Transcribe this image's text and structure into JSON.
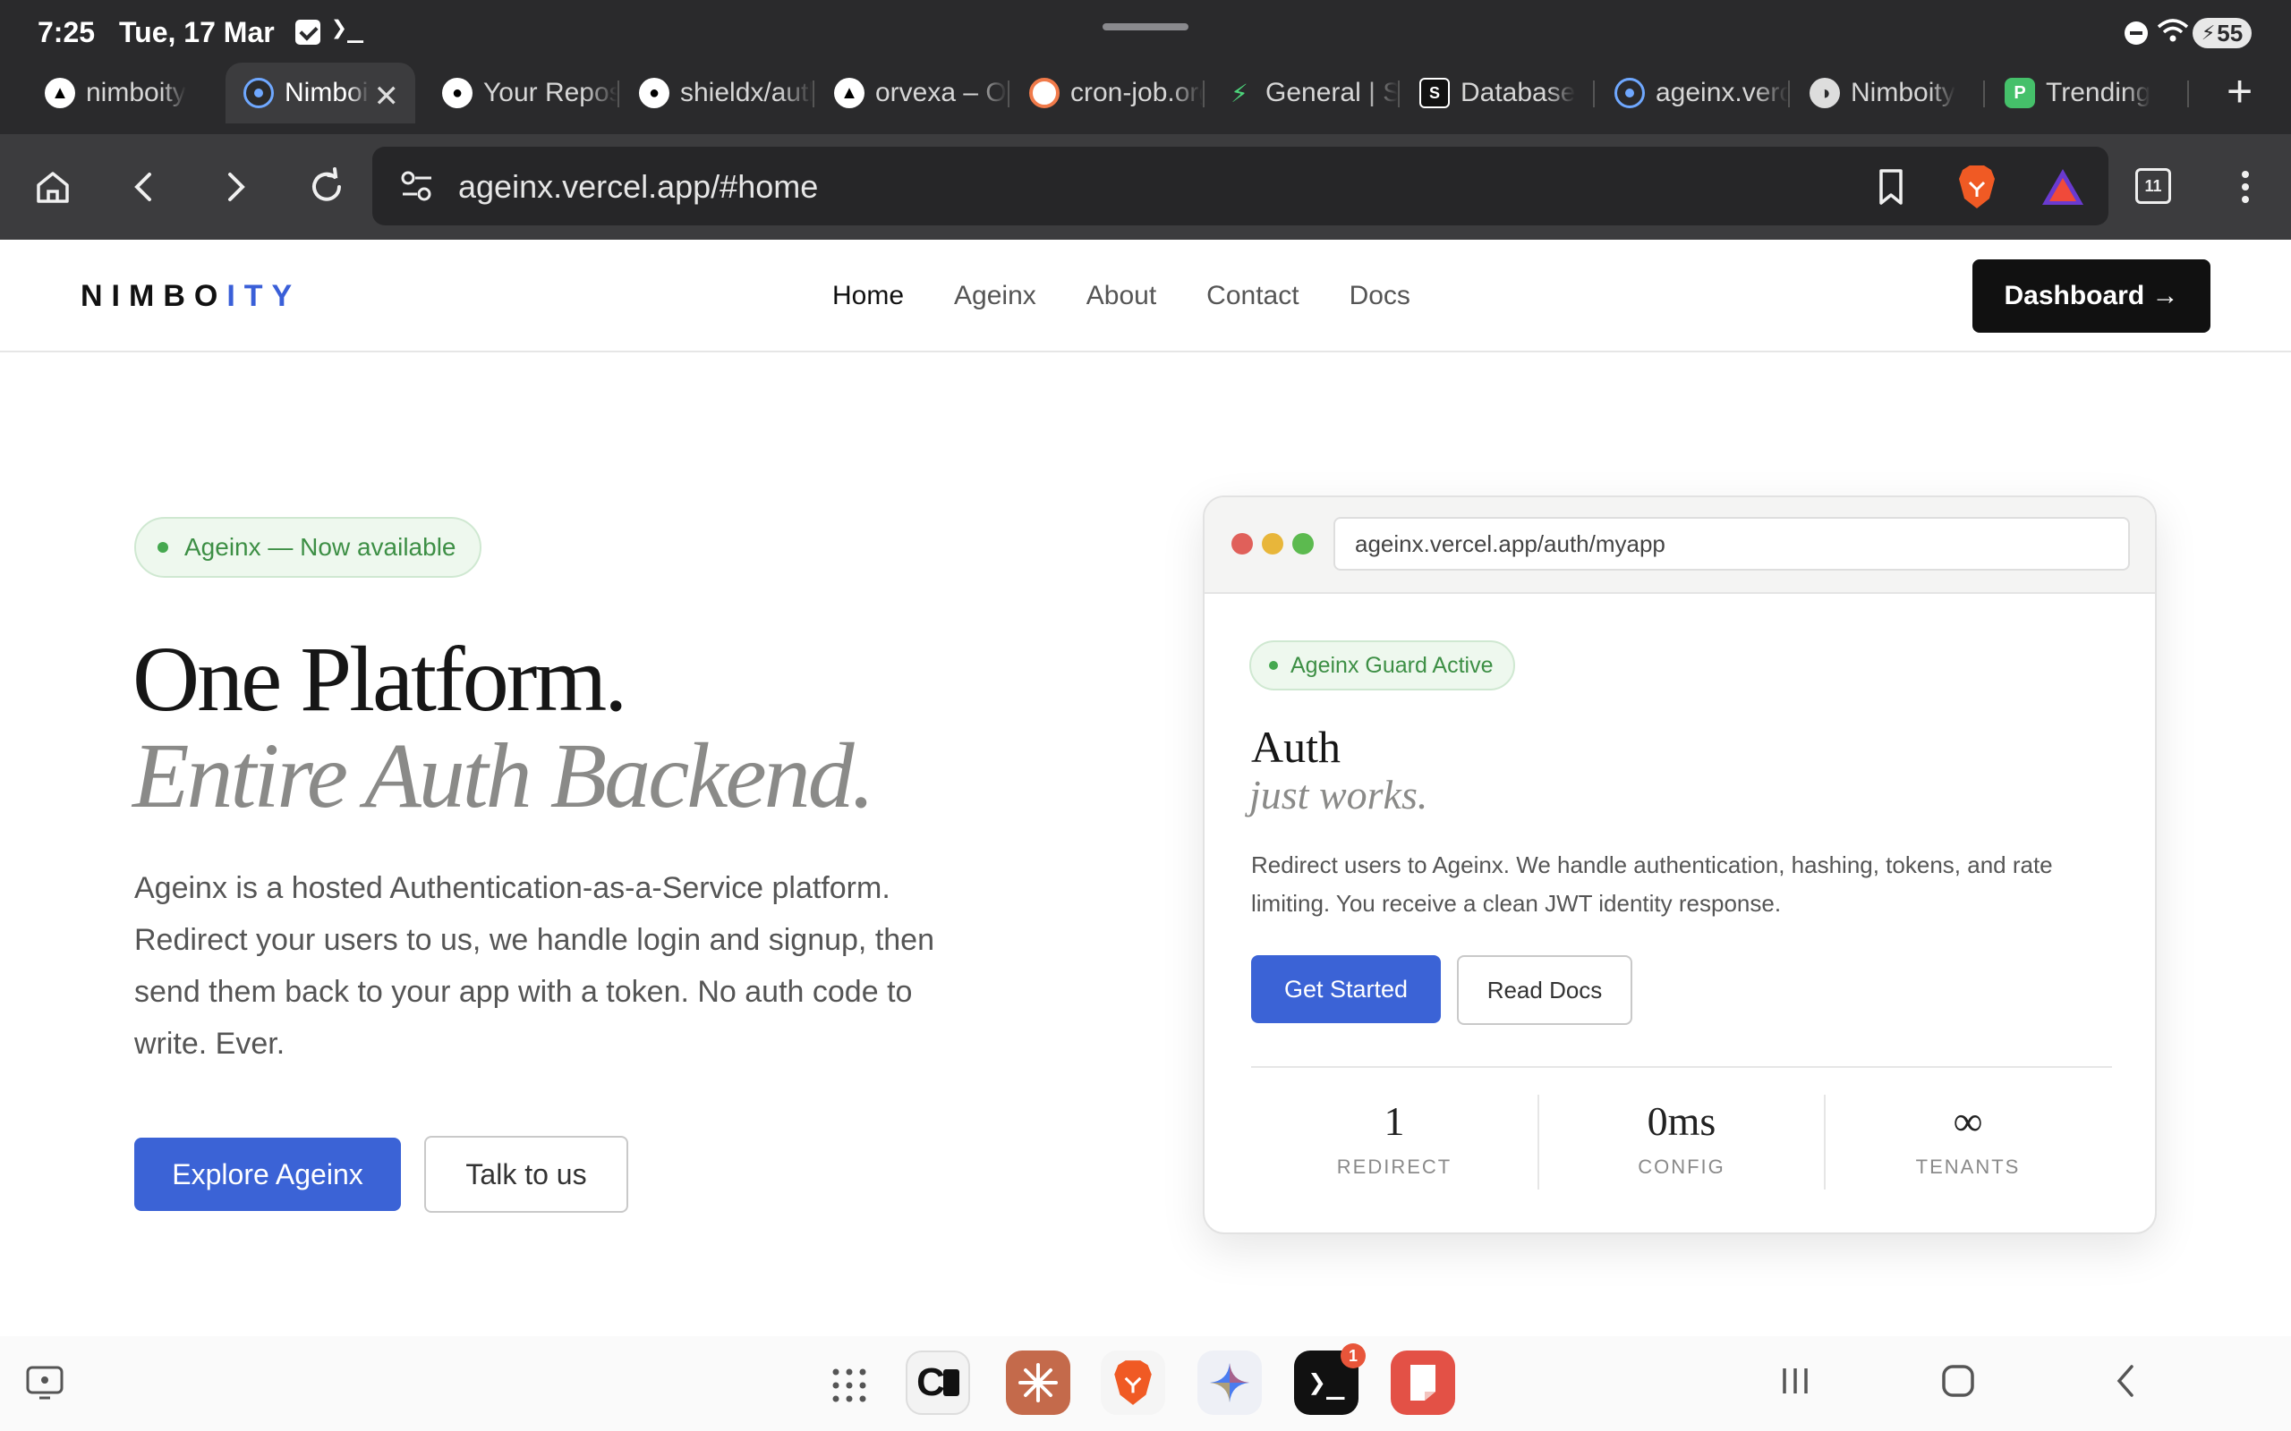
{
  "status_bar": {
    "time": "7:25",
    "date": "Tue, 17 Mar",
    "terminal_glyph": "❯_",
    "battery": "55"
  },
  "tabs": [
    {
      "label": "nimboity",
      "icon": "vercel-triangle-icon"
    },
    {
      "label": "Nimboity",
      "icon": "nimboity-icon",
      "active": true
    },
    {
      "label": "Your Repositories",
      "icon": "github-icon"
    },
    {
      "label": "shieldx/auth",
      "icon": "github-icon"
    },
    {
      "label": "orvexa – Overview",
      "icon": "vercel-triangle-icon"
    },
    {
      "label": "cron-job.org",
      "icon": "cron-job-icon"
    },
    {
      "label": "General | Settings",
      "icon": "bolt-icon"
    },
    {
      "label": "Database",
      "icon": "database-icon"
    },
    {
      "label": "ageinx.vercel.app",
      "icon": "nimboity-icon"
    },
    {
      "label": "Nimboity",
      "icon": "globe-icon"
    },
    {
      "label": "Trending",
      "icon": "p-badge-icon"
    }
  ],
  "toolbar": {
    "url": "ageinx.vercel.app/#home",
    "tab_count": "11"
  },
  "site": {
    "logo_main": "NIMBO",
    "logo_accent": "ITY",
    "nav": [
      "Home",
      "Ageinx",
      "About",
      "Contact",
      "Docs"
    ],
    "dashboard_label": "Dashboard →"
  },
  "hero": {
    "badge": "Ageinx — Now available",
    "title_line1": "One Platform.",
    "title_line2": "Entire Auth Backend.",
    "description": "Ageinx is a hosted Authentication-as-a-Service platform. Redirect your users to us, we handle login and signup, then send them back to your app with a token. No auth code to write. Ever.",
    "primary_cta": "Explore Ageinx",
    "secondary_cta": "Talk to us"
  },
  "card": {
    "url": "ageinx.vercel.app/auth/myapp",
    "badge": "Ageinx Guard Active",
    "title_line1": "Auth",
    "title_line2": "just works.",
    "description": "Redirect users to Ageinx. We handle authentication, hashing, tokens, and rate limiting. You receive a clean JWT identity response.",
    "primary_btn": "Get Started",
    "secondary_btn": "Read Docs",
    "stats": [
      {
        "value": "1",
        "label": "REDIRECT"
      },
      {
        "value": "0ms",
        "label": "CONFIG"
      },
      {
        "value": "∞",
        "label": "TENANTS"
      }
    ]
  },
  "dock": {
    "terminal_badge": "1"
  },
  "colors": {
    "accent": "#3b63d6",
    "success": "#45a84f",
    "dark": "#111111",
    "browser_chrome": "#2a2a2c"
  }
}
